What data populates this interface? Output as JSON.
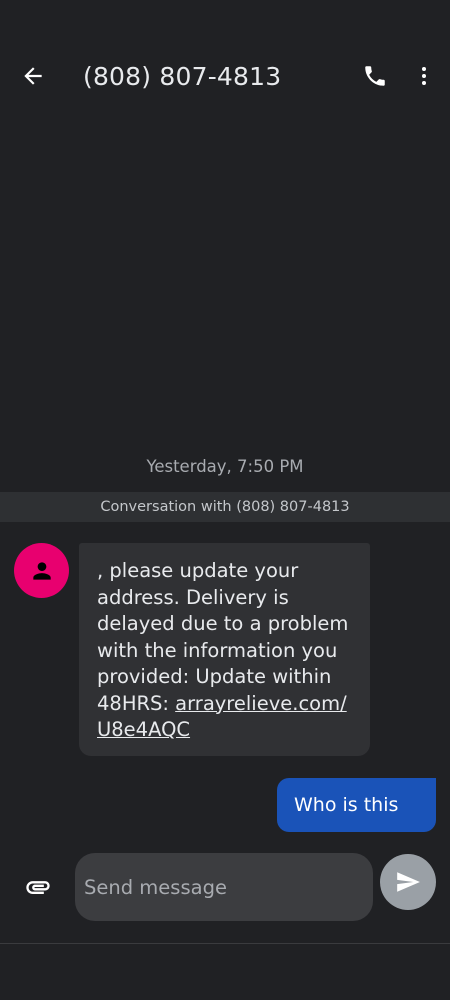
{
  "app_bar": {
    "title": "(808) 807-4813",
    "icons": [
      "back-arrow-icon",
      "phone-icon",
      "more-vert-icon"
    ]
  },
  "conversation": {
    "timestamp": "Yesterday, 7:50 PM",
    "banner": "Conversation with (808) 807-4813",
    "incoming": {
      "text": ", please update your address. Delivery is delayed due to a problem with the information you provided: Update within 48HRS: ",
      "link": "arrayrelieve.com/U8e4AQC"
    },
    "outgoing": {
      "text": "Who is this"
    }
  },
  "composer": {
    "placeholder": "Send message",
    "value": ""
  },
  "colors": {
    "background": "#202124",
    "avatar": "#e8006f",
    "outgoing_bubble": "#1a53b8",
    "incoming_bubble": "#303134",
    "send_button": "#9aa0a6"
  }
}
